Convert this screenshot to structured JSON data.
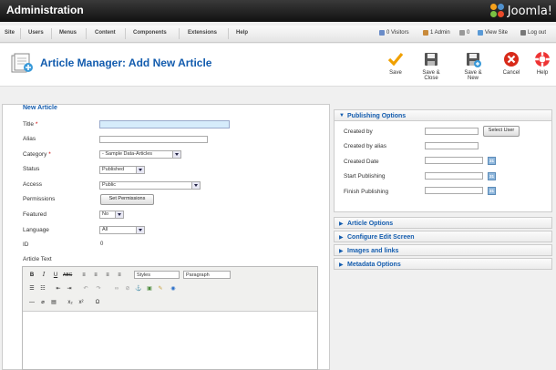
{
  "app": {
    "title": "Administration",
    "logo_text": "Joomla!"
  },
  "menu": {
    "items": [
      "Site",
      "Users",
      "Menus",
      "Content",
      "Components",
      "Extensions",
      "Help"
    ]
  },
  "status": {
    "visitors": "0 Visitors",
    "admins": "1 Admin",
    "messages": "0",
    "view_site": "View Site",
    "log_out": "Log out"
  },
  "page": {
    "title": "Article Manager: Add New Article"
  },
  "toolbar": {
    "save": "Save",
    "save_close": "Save & Close",
    "save_new": "Save & New",
    "cancel": "Cancel",
    "help": "Help"
  },
  "form": {
    "legend": "New Article",
    "title_label": "Title",
    "required_mark": "*",
    "alias_label": "Alias",
    "category_label": "Category",
    "category_value": "- Sample Data-Articles",
    "status_label": "Status",
    "status_value": "Published",
    "access_label": "Access",
    "access_value": "Public",
    "permissions_label": "Permissions",
    "permissions_button": "Set Permissions",
    "featured_label": "Featured",
    "featured_value": "No",
    "language_label": "Language",
    "language_value": "All",
    "id_label": "ID",
    "id_value": "0",
    "article_text_label": "Article Text"
  },
  "editor": {
    "styles_value": "Styles",
    "format_value": "Paragraph"
  },
  "publishing": {
    "header": "Publishing Options",
    "created_by": "Created by",
    "select_user": "Select User",
    "created_by_alias": "Created by alias",
    "created_date": "Created Date",
    "start_publishing": "Start Publishing",
    "finish_publishing": "Finish Publishing",
    "calendar_glyph": "31"
  },
  "panels": [
    "Article Options",
    "Configure Edit Screen",
    "Images and links",
    "Metadata Options"
  ],
  "colors": {
    "accent": "#135cae",
    "topbar": "#1e1e1e",
    "required": "#cc0000",
    "save_icon": "#f0a000",
    "cancel_icon": "#d82a1a"
  }
}
